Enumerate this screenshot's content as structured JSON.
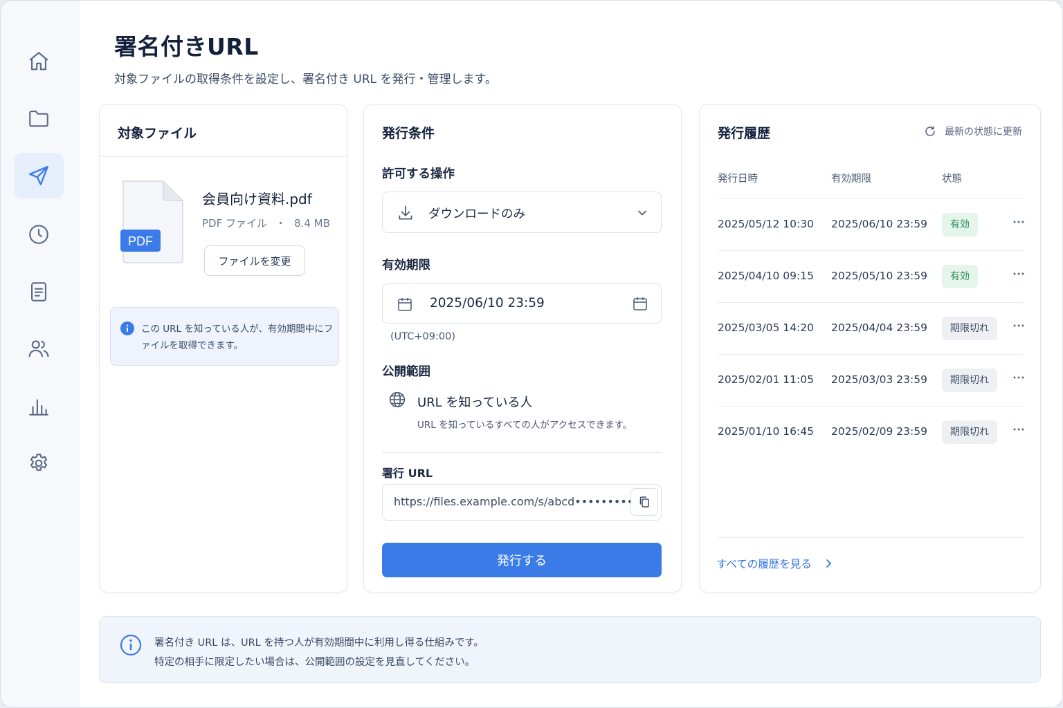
{
  "colors": {
    "accent": "#3b7be8",
    "valid_bg": "#e5f5ec",
    "valid_text": "#2b8a57",
    "expired_bg": "#eef0f4"
  },
  "sidebar": {
    "items": [
      {
        "icon": "home-icon",
        "active": false
      },
      {
        "icon": "folder-icon",
        "active": false
      },
      {
        "icon": "send-icon",
        "active": true
      },
      {
        "icon": "clock-icon",
        "active": false
      },
      {
        "icon": "document-icon",
        "active": false
      },
      {
        "icon": "users-icon",
        "active": false
      },
      {
        "icon": "bar-chart-icon",
        "active": false
      },
      {
        "icon": "gear-icon",
        "active": false
      }
    ]
  },
  "header": {
    "title": "署名付きURL",
    "subtitle": "対象ファイルの取得条件を設定し、署名付き URL を発行・管理します。"
  },
  "file_card": {
    "title": "対象ファイル",
    "file_name": "会員向け資料.pdf",
    "file_type": "PDF ファイル",
    "separator": "・",
    "file_size": "8.4 MB",
    "file_badge": "PDF",
    "change_button": "ファイルを変更",
    "info_text": "この URL を知っている人が、有効期間中にファイルを取得できます。"
  },
  "conditions": {
    "title": "発行条件",
    "operation_label": "許可する操作",
    "operation_value": "ダウンロードのみ",
    "expiry_label": "有効期限",
    "expiry_value": "2025/06/10 23:59",
    "timezone": "(UTC+09:00)",
    "scope_label": "公開範囲",
    "scope_title": "URL を知っている人",
    "scope_desc": "URL を知っているすべての人がアクセスできます。",
    "url_label": "署行 URL",
    "url_value": "https://files.example.com/s/abcd•••••••••",
    "issue_button": "発行する"
  },
  "history": {
    "title": "発行履歴",
    "refresh": "最新の状態に更新",
    "columns": [
      "発行日時",
      "有効期限",
      "状態"
    ],
    "rows": [
      {
        "issued": "2025/05/12 10:30",
        "expires": "2025/06/10 23:59",
        "status": "有効",
        "kind": "valid"
      },
      {
        "issued": "2025/04/10 09:15",
        "expires": "2025/05/10 23:59",
        "status": "有効",
        "kind": "valid"
      },
      {
        "issued": "2025/03/05 14:20",
        "expires": "2025/04/04 23:59",
        "status": "期限切れ",
        "kind": "expired"
      },
      {
        "issued": "2025/02/01 11:05",
        "expires": "2025/03/03 23:59",
        "status": "期限切れ",
        "kind": "expired"
      },
      {
        "issued": "2025/01/10 16:45",
        "expires": "2025/02/09 23:59",
        "status": "期限切れ",
        "kind": "expired"
      }
    ],
    "view_all": "すべての履歴を見る"
  },
  "notice": {
    "line1": "署名付き URL は、URL を持つ人が有効期間中に利用し得る仕組みです。",
    "line2": "特定の相手に限定したい場合は、公開範囲の設定を見直してください。"
  }
}
